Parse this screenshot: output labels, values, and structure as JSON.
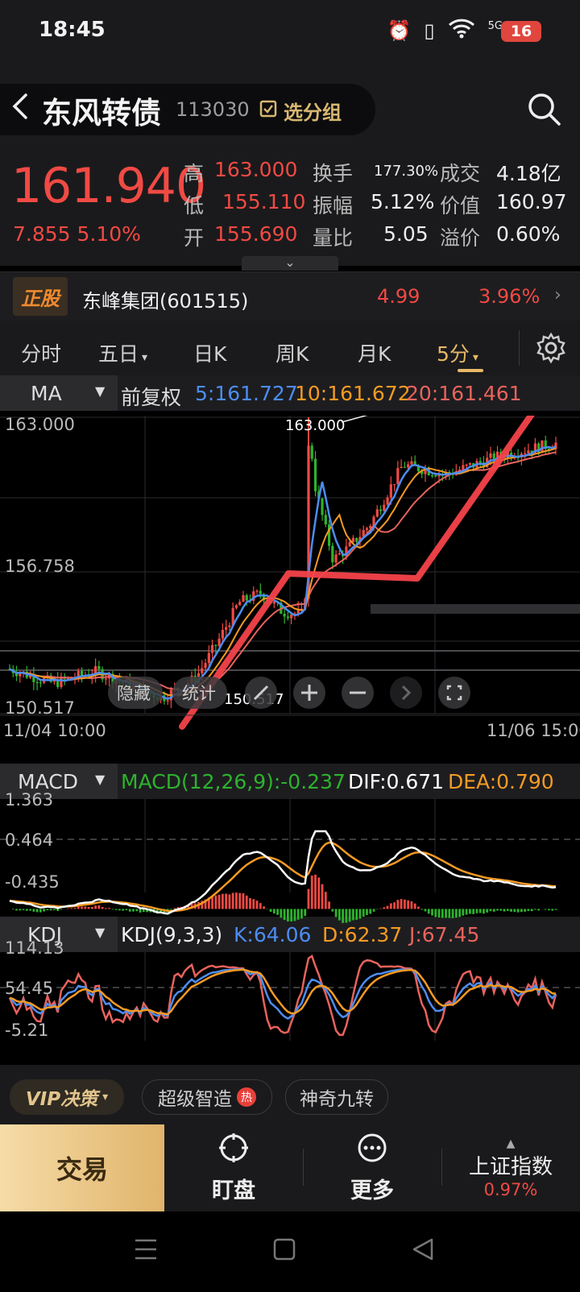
{
  "status_bar": {
    "time": "18:45",
    "battery": "16",
    "signal": "5G"
  },
  "header": {
    "title": "东风转债",
    "code": "113030",
    "group_label": "选分组",
    "price": "161.940",
    "change": "7.855 5.10%"
  },
  "quote": {
    "high": {
      "label": "高",
      "value": "163.000"
    },
    "low": {
      "label": "低",
      "value": "155.110"
    },
    "open": {
      "label": "开",
      "value": "155.690"
    },
    "turnover": {
      "label": "换手",
      "value": "177.30%"
    },
    "amplitude": {
      "label": "振幅",
      "value": "5.12%"
    },
    "volume_ratio": {
      "label": "量比",
      "value": "5.05"
    },
    "deal": {
      "label": "成交",
      "value": "4.18亿"
    },
    "worth": {
      "label": "价值",
      "value": "160.97"
    },
    "premium": {
      "label": "溢价",
      "value": "0.60%"
    }
  },
  "related_stock": {
    "badge": "正股",
    "name": "东峰集团(601515)",
    "price": "4.99",
    "pct": "3.96%"
  },
  "tabs": [
    {
      "label": "分时"
    },
    {
      "label": "五日",
      "caret": "▾"
    },
    {
      "label": "日K"
    },
    {
      "label": "周K"
    },
    {
      "label": "月K"
    },
    {
      "label": "5分",
      "caret": "▾"
    }
  ],
  "ma_header": {
    "select": "MA",
    "adjust": "前复权",
    "ma5": "5:161.727",
    "ma10": "10:161.672",
    "ma20": "20:161.461"
  },
  "main_chart": {
    "y_top": "163.000",
    "y_mid": "156.758",
    "y_bottom": "150.517",
    "high_label": "163.000",
    "low_label": "150.517",
    "x_start": "11/04 10:00",
    "x_end": "11/06 15:00",
    "controls": [
      "隐藏",
      "统计"
    ]
  },
  "macd_header": {
    "select": "MACD",
    "params": "MACD(12,26,9):-0.237",
    "dif": "DIF:0.671",
    "dea": "DEA:0.790"
  },
  "macd_axis": {
    "top": "1.363",
    "mid": "0.464",
    "bottom": "-0.435"
  },
  "kdj_header": {
    "select": "KDJ",
    "params": "KDJ(9,3,3)",
    "k": "K:64.06",
    "d": "D:62.37",
    "j": "J:67.45"
  },
  "kdj_axis": {
    "top": "114.13",
    "mid": "54.45",
    "bottom": "-5.21"
  },
  "chips": {
    "vip": "VIP决策",
    "smart": "超级智造",
    "hot": "热",
    "nine": "神奇九转"
  },
  "bottom_bar": {
    "trade": "交易",
    "watch": "盯盘",
    "more": "更多",
    "index_name": "上证指数",
    "index_pct": "0.97%"
  },
  "colors": {
    "up": "#f04a44",
    "down": "#2db32d",
    "ma5": "#4c8df0",
    "ma10": "#f59a23",
    "ma20": "#e8635c",
    "accent": "#e6b867"
  }
}
